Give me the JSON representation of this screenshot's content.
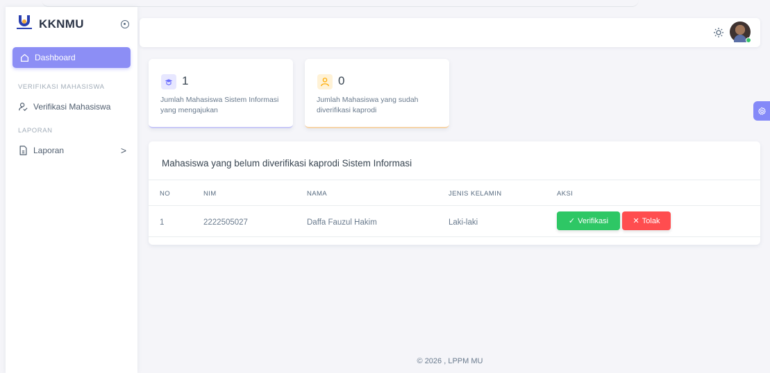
{
  "brand": {
    "name": "KKNMU"
  },
  "sidebar": {
    "active_item": "Dashboard",
    "sections": [
      {
        "header": "VERIFIKASI MAHASISWA",
        "items": [
          {
            "label": "Verifikasi Mahasiswa",
            "icon": "user-check-icon"
          }
        ]
      },
      {
        "header": "LAPORAN",
        "items": [
          {
            "label": "Laporan",
            "icon": "file-icon",
            "chevron": ">"
          }
        ]
      }
    ]
  },
  "stats": [
    {
      "value": "1",
      "label": "Jumlah Mahasiswa Sistem Informasi yang mengajukan",
      "icon": "graduation-icon",
      "accent": "#696cff"
    },
    {
      "value": "0",
      "label": "Jumlah Mahasiswa yang sudah diverifikasi kaprodi",
      "icon": "user-icon",
      "accent": "#ffab00"
    }
  ],
  "table": {
    "title": "Mahasiswa yang belum diverifikasi kaprodi Sistem Informasi",
    "columns": [
      "NO",
      "NIM",
      "NAMA",
      "JENIS KELAMIN",
      "AKSI"
    ],
    "rows": [
      {
        "no": "1",
        "nim": "2222505027",
        "nama": "Daffa Fauzul Hakim",
        "jenis_kelamin": "Laki-laki"
      }
    ],
    "actions": {
      "verify": "Verifikasi",
      "reject": "Tolak"
    }
  },
  "footer": {
    "text": "© 2026 , LPPM MU"
  },
  "colors": {
    "primary": "#696cff",
    "success": "#2ec765",
    "danger": "#ff4d4f",
    "warning": "#ffab00"
  }
}
